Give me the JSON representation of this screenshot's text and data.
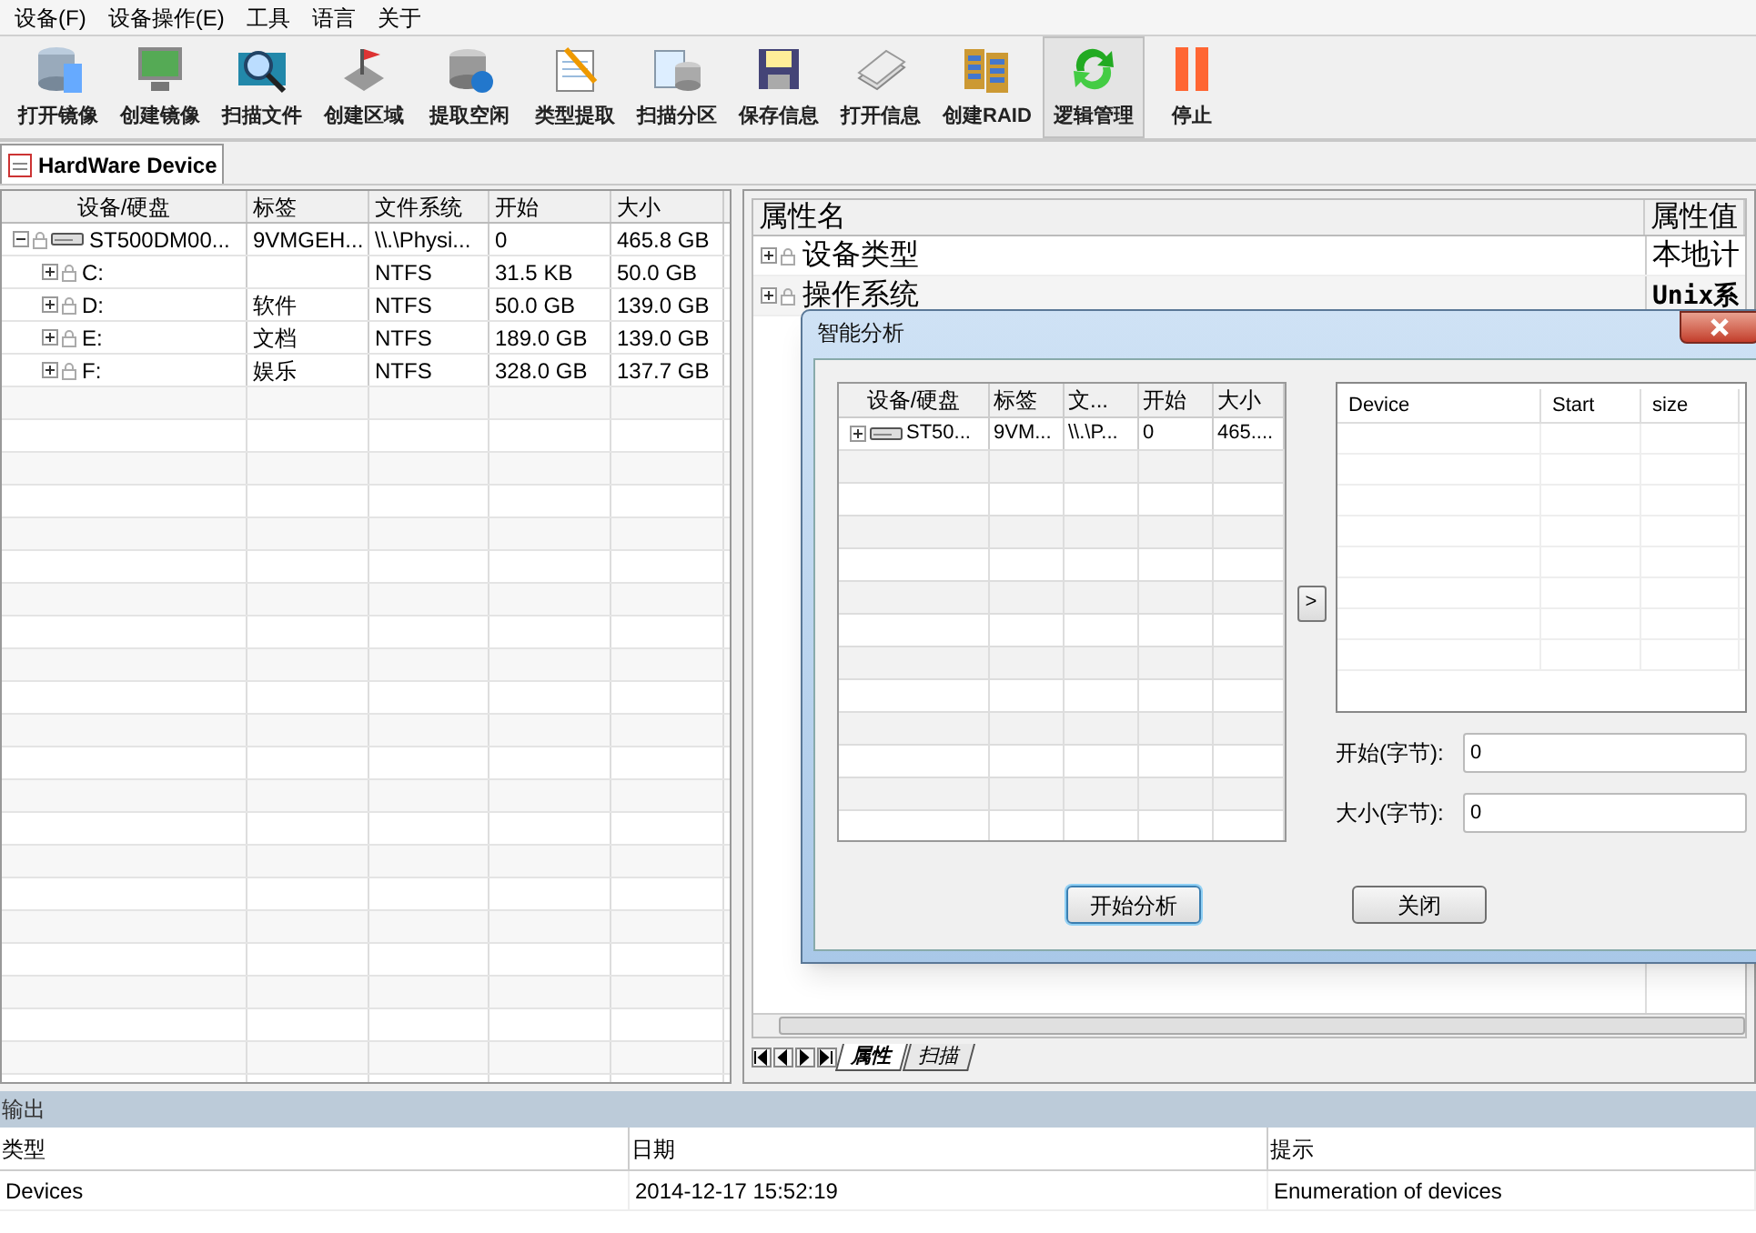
{
  "menu": [
    "设备(F)",
    "设备操作(E)",
    "工具",
    "语言",
    "关于"
  ],
  "toolbar": [
    {
      "label": "打开镜像",
      "selected": false
    },
    {
      "label": "创建镜像",
      "selected": false
    },
    {
      "label": "扫描文件",
      "selected": false
    },
    {
      "label": "创建区域",
      "selected": false
    },
    {
      "label": "提取空闲",
      "selected": false
    },
    {
      "label": "类型提取",
      "selected": false
    },
    {
      "label": "扫描分区",
      "selected": false
    },
    {
      "label": "保存信息",
      "selected": false
    },
    {
      "label": "打开信息",
      "selected": false
    },
    {
      "label": "创建RAID",
      "selected": false
    },
    {
      "label": "逻辑管理",
      "selected": true
    },
    {
      "label": "停止",
      "selected": false
    }
  ],
  "doc_tab": {
    "label": "HardWare Device"
  },
  "device_table": {
    "columns": [
      "设备/硬盘",
      "标签",
      "文件系统",
      "开始",
      "大小"
    ],
    "rows": [
      {
        "name": "ST500DM00...",
        "label": "9VMGEH...",
        "file_system": "\\\\.\\Physi...",
        "start": "0",
        "size": "465.8 GB",
        "expanded": true,
        "children": [
          {
            "name": "C:",
            "file_system": "NTFS",
            "start": "31.5 KB",
            "size": "50.0 GB",
            "expanded": false
          },
          {
            "name": "D:",
            "label": "软件",
            "file_system": "NTFS",
            "start": "50.0 GB",
            "size": "139.0 GB",
            "expanded": false
          },
          {
            "name": "E:",
            "label": "文档",
            "file_system": "NTFS",
            "start": "189.0 GB",
            "size": "139.0 GB",
            "expanded": false
          },
          {
            "name": "F:",
            "label": "娱乐",
            "file_system": "NTFS",
            "start": "328.0 GB",
            "size": "137.7 GB",
            "expanded": false
          }
        ]
      }
    ]
  },
  "properties": {
    "columns": [
      "属性名",
      "属性值"
    ],
    "rows": [
      {
        "name": "设备类型",
        "value": "本地计",
        "expanded": false
      },
      {
        "name": "操作系统",
        "value": "Unix系",
        "expanded": false
      }
    ]
  },
  "bottom_tabs": [
    {
      "label": "属性",
      "selected": true
    },
    {
      "label": "扫描",
      "selected": false
    }
  ],
  "dialog": {
    "title": "智能分析",
    "device_table": {
      "columns": [
        "设备/硬盘",
        "标签",
        "文...",
        "开始",
        "大小"
      ],
      "rows": [
        {
          "name": "ST50...",
          "label": "9VM...",
          "file_system": "\\\\.\\P...",
          "start": "0",
          "size": "465....",
          "expanded": false
        }
      ]
    },
    "add_button": ">",
    "result_list": {
      "columns": [
        "Device",
        "Start",
        "size"
      ]
    },
    "fields": [
      {
        "label": "开始(字节):",
        "value": "0"
      },
      {
        "label": "大小(字节):",
        "value": "0"
      }
    ],
    "buttons": [
      {
        "label": "开始分析",
        "selected": true
      },
      {
        "label": "关闭",
        "selected": false
      }
    ]
  },
  "output": {
    "title": "输出",
    "columns": [
      "类型",
      "日期",
      "提示"
    ],
    "rows": [
      {
        "type": "Devices",
        "date": "2014-12-17 15:52:19",
        "hint": "Enumeration of devices"
      }
    ]
  }
}
